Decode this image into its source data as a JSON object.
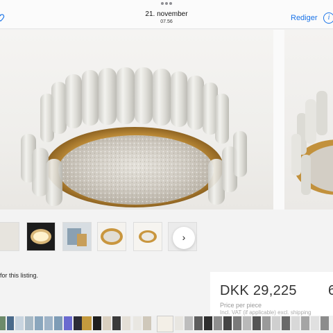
{
  "header": {
    "date": "21. november",
    "time": "07.56",
    "edit_label": "Rediger",
    "info_glyph": "i",
    "favorite_icon": "heart-icon"
  },
  "gallery": {
    "main_image": "crystal glass tube ceiling lamp",
    "next_glyph": "›"
  },
  "listing": {
    "note": "for this listing."
  },
  "price": {
    "amount": "DKK 29,225",
    "extra_amount": "6",
    "label": "Price per piece",
    "sub": "Incl. VAT (if applicable) excl. shipping"
  },
  "colors": {
    "accent": "#1a73e8",
    "background": "#f3f3f3"
  }
}
